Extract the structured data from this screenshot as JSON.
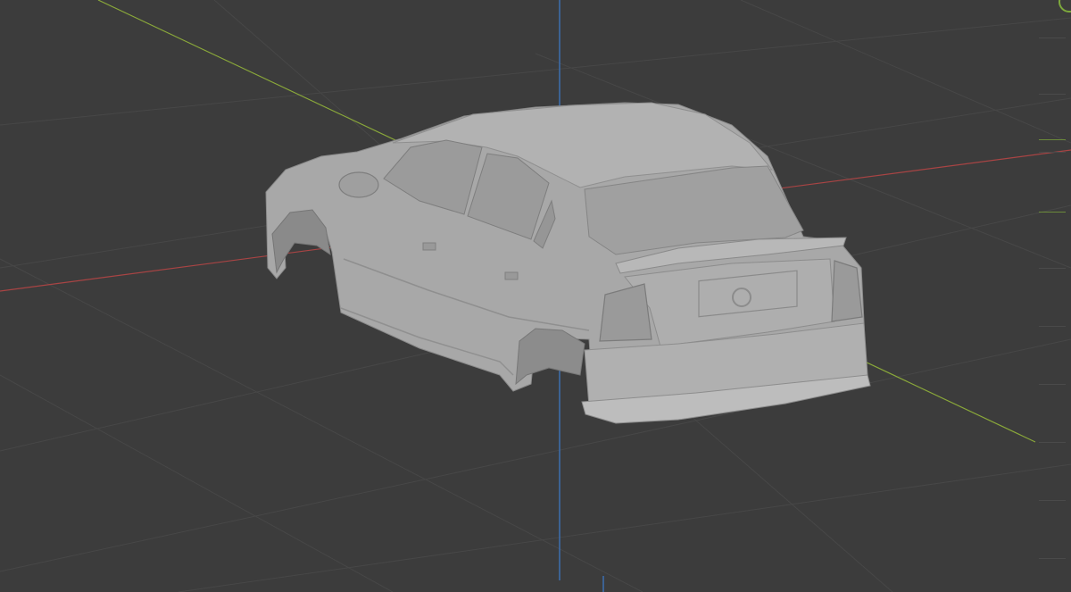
{
  "viewport": {
    "background": "#3c3c3c",
    "grid_color": "#4a4a4a",
    "x_axis_color": "#b04a4a",
    "y_axis_color": "#8aa83a",
    "z_axis_color": "#3d6fb0",
    "model_color": "#a9a9a9"
  },
  "gizmo": {
    "icon": "navigation-gizmo-icon",
    "color": "#7da83c"
  },
  "scene_object": {
    "name_icon": "car-body-mesh-icon"
  }
}
